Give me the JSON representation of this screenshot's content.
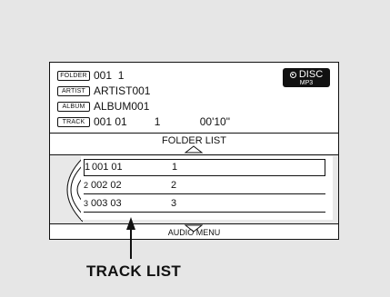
{
  "info": {
    "folder_tag": "FOLDER",
    "folder_value": "001  1",
    "artist_tag": "ARTIST",
    "artist_value": "ARTIST001",
    "album_tag": "ALBUM",
    "album_value": "ALBUM001",
    "track_tag": "TRACK",
    "track_value": "001 01         1             00'10\""
  },
  "source": {
    "label": "DISC",
    "format": "MP3"
  },
  "folder_list_label": "FOLDER LIST",
  "tracks": [
    {
      "index": "1",
      "code": "001 01",
      "track": "1"
    },
    {
      "index": "2",
      "code": "002 02",
      "track": "2"
    },
    {
      "index": "3",
      "code": "003 03",
      "track": "3"
    }
  ],
  "audio_menu_label": "AUDIO MENU",
  "callout": "TRACK LIST"
}
